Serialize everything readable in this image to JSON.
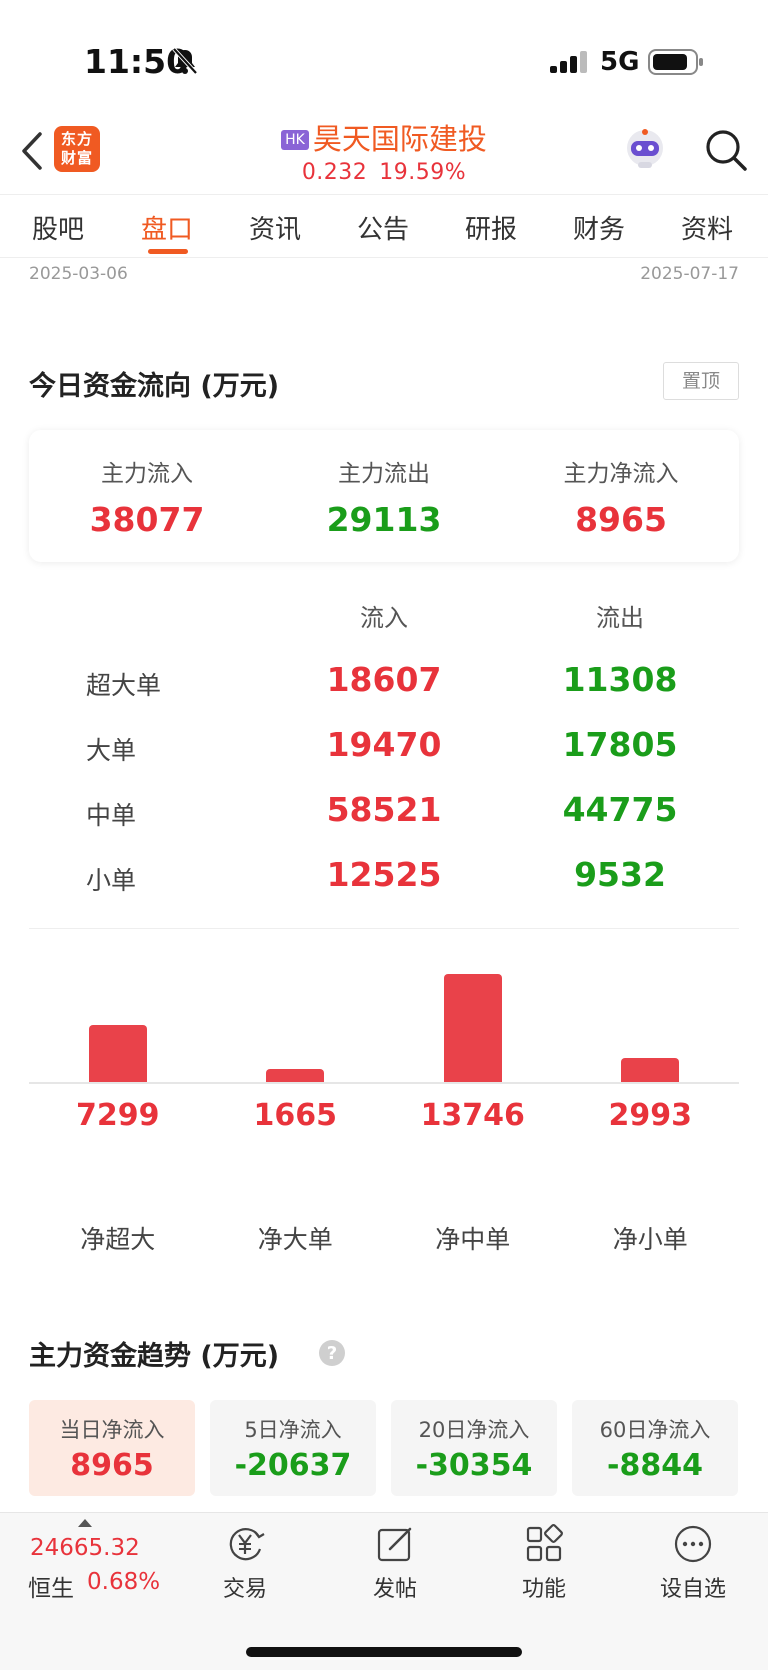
{
  "status_bar": {
    "time": "11:50",
    "network": "5G"
  },
  "header": {
    "logo_line1": "东方",
    "logo_line2": "财富",
    "market_badge": "HK",
    "stock_name": "昊天国际建投",
    "price": "0.232",
    "change_pct": "19.59%"
  },
  "tabs": [
    {
      "label": "股吧",
      "active": false
    },
    {
      "label": "盘口",
      "active": true
    },
    {
      "label": "资讯",
      "active": false
    },
    {
      "label": "公告",
      "active": false
    },
    {
      "label": "研报",
      "active": false
    },
    {
      "label": "财务",
      "active": false
    },
    {
      "label": "资料",
      "active": false
    }
  ],
  "date_range": {
    "start": "2025-03-06",
    "end": "2025-07-17"
  },
  "fund_flow": {
    "title": "今日资金流向 (万元)",
    "pin_label": "置顶",
    "summary": [
      {
        "label": "主力流入",
        "value": "38077",
        "color": "#e8333b"
      },
      {
        "label": "主力流出",
        "value": "29113",
        "color": "#1a9d1a"
      },
      {
        "label": "主力净流入",
        "value": "8965",
        "color": "#e8333b"
      }
    ],
    "column_in": "流入",
    "column_out": "流出",
    "rows": [
      {
        "label": "超大单",
        "in": "18607",
        "out": "11308"
      },
      {
        "label": "大单",
        "in": "19470",
        "out": "17805"
      },
      {
        "label": "中单",
        "in": "58521",
        "out": "44775"
      },
      {
        "label": "小单",
        "in": "12525",
        "out": "9532"
      }
    ]
  },
  "chart_data": {
    "type": "bar",
    "categories": [
      "净超大",
      "净大单",
      "净中单",
      "净小单"
    ],
    "values": [
      7299,
      1665,
      13746,
      2993
    ],
    "title": "",
    "xlabel": "",
    "ylabel": "",
    "ylim": [
      0,
      13746
    ],
    "bar_color": "#e9424a",
    "grid": false
  },
  "trend": {
    "title": "主力资金趋势 (万元)",
    "cards": [
      {
        "label": "当日净流入",
        "value": "8965",
        "color": "#e8333b",
        "active": true
      },
      {
        "label": "5日净流入",
        "value": "-20637",
        "color": "#1a9d1a",
        "active": false
      },
      {
        "label": "20日净流入",
        "value": "-30354",
        "color": "#1a9d1a",
        "active": false
      },
      {
        "label": "60日净流入",
        "value": "-8844",
        "color": "#1a9d1a",
        "active": false
      }
    ]
  },
  "bottom_bar": {
    "index_value": "24665.32",
    "index_name": "恒生",
    "index_change": "0.68%",
    "nav": [
      {
        "label": "交易",
        "icon": "yen-cycle-icon"
      },
      {
        "label": "发帖",
        "icon": "edit-icon"
      },
      {
        "label": "功能",
        "icon": "grid-icon"
      },
      {
        "label": "设自选",
        "icon": "more-icon"
      }
    ]
  }
}
